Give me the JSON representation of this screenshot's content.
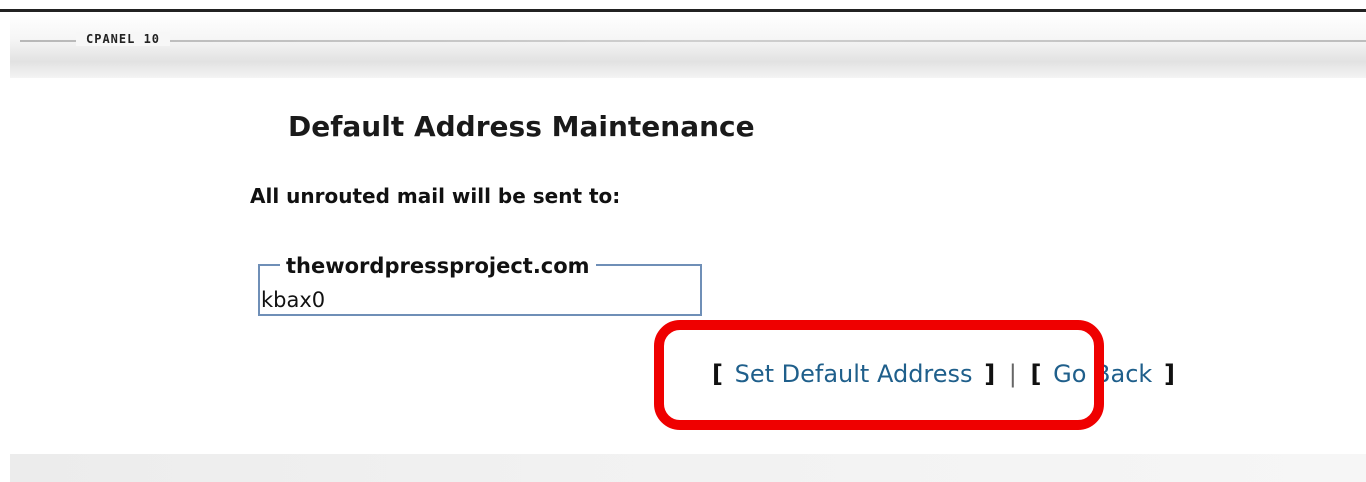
{
  "header": {
    "brand": "CPANEL 10"
  },
  "main": {
    "title": "Default Address Maintenance",
    "subheading": "All unrouted mail will be sent to:",
    "domain_legend": "thewordpressproject.com",
    "address_value": "kbax0"
  },
  "actions": {
    "open_bracket": "[",
    "close_bracket": "]",
    "separator": "|",
    "set_default_label": "Set Default Address",
    "go_back_label": "Go Back"
  },
  "annotation": {
    "highlight_color": "#ef0000"
  }
}
